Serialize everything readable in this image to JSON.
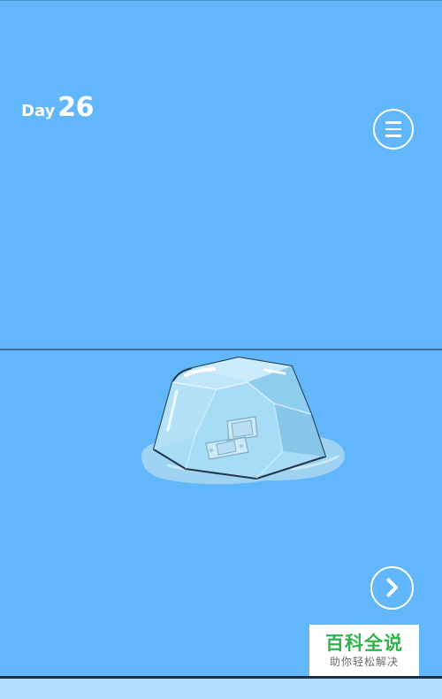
{
  "hud": {
    "day_word": "Day",
    "day_number": "26"
  },
  "buttons": {
    "menu_icon": "hamburger-menu-icon",
    "next_icon": "chevron-right-icon"
  },
  "scene": {
    "object": "handheld-game-console-frozen-in-ice"
  },
  "watermark": {
    "title": "百科全说",
    "subtitle": "助你轻松解决"
  },
  "colors": {
    "background": "#62b6fc",
    "ice": "#a6dcf5",
    "accent_white": "#ffffff",
    "watermark_green": "#2fb34b"
  }
}
